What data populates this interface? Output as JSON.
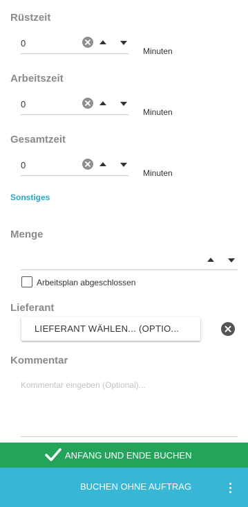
{
  "fields": {
    "setup": {
      "label": "Rüstzeit",
      "value": "0",
      "unit": "Minuten"
    },
    "work": {
      "label": "Arbeitszeit",
      "value": "0",
      "unit": "Minuten"
    },
    "total": {
      "label": "Gesamtzeit",
      "value": "0",
      "unit": "Minuten"
    }
  },
  "other": {
    "heading": "Sonstiges"
  },
  "quantity": {
    "label": "Menge",
    "value": ""
  },
  "checkbox": {
    "label": "Arbeitsplan abgeschlossen",
    "checked": false
  },
  "supplier": {
    "label": "Lieferant",
    "button_label": "LIEFERANT WÄHLEN... (OPTIO..."
  },
  "comment": {
    "label": "Kommentar",
    "placeholder": "Kommentar eingeben (Optional)..."
  },
  "actions": {
    "book_start_end": "ANFANG UND ENDE BUCHEN",
    "book_without_order": "BUCHEN OHNE AUFTRAG"
  },
  "colors": {
    "link": "#2aa6c8",
    "green": "#24a35a",
    "blue": "#37b6d6"
  },
  "icons": [
    "clear-icon",
    "arrow-up-icon",
    "arrow-down-icon",
    "checkmark-icon",
    "more-vertical-icon"
  ]
}
